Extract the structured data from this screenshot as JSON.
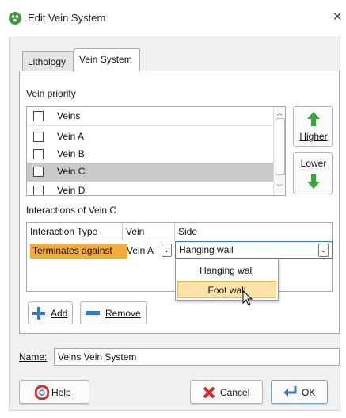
{
  "window": {
    "title": "Edit Vein System",
    "close_glyph": "✕",
    "app_icon": "app-logo-icon"
  },
  "tabs": [
    {
      "label": "Lithology",
      "active": false
    },
    {
      "label": "Vein System",
      "active": true
    }
  ],
  "vein_priority": {
    "label": "Vein priority",
    "header": "Veins",
    "items": [
      {
        "label": "Vein A",
        "selected": false
      },
      {
        "label": "Vein B",
        "selected": false
      },
      {
        "label": "Vein C",
        "selected": true
      },
      {
        "label": "Vein D",
        "selected": false
      }
    ],
    "higher_label": "Higher",
    "lower_label": "Lower"
  },
  "interactions": {
    "label": "Interactions of Vein C",
    "columns": [
      "Interaction Type",
      "Vein",
      "Side"
    ],
    "row": {
      "type": "Terminates against",
      "vein": "Vein A",
      "side": "Hanging wall"
    },
    "dropdown_options": [
      "Hanging wall",
      "Foot wall"
    ],
    "highlighted_option": "Foot wall",
    "add_label": "Add",
    "remove_label": "Remove"
  },
  "name": {
    "label": "Name:",
    "value": "Veins Vein System"
  },
  "footer": {
    "help_label": "Help",
    "cancel_label": "Cancel",
    "ok_label": "OK"
  },
  "colors": {
    "accent_green": "#3e9b3a",
    "interaction_highlight": "#f3ac3c",
    "focus_blue": "#2a7fd4"
  }
}
